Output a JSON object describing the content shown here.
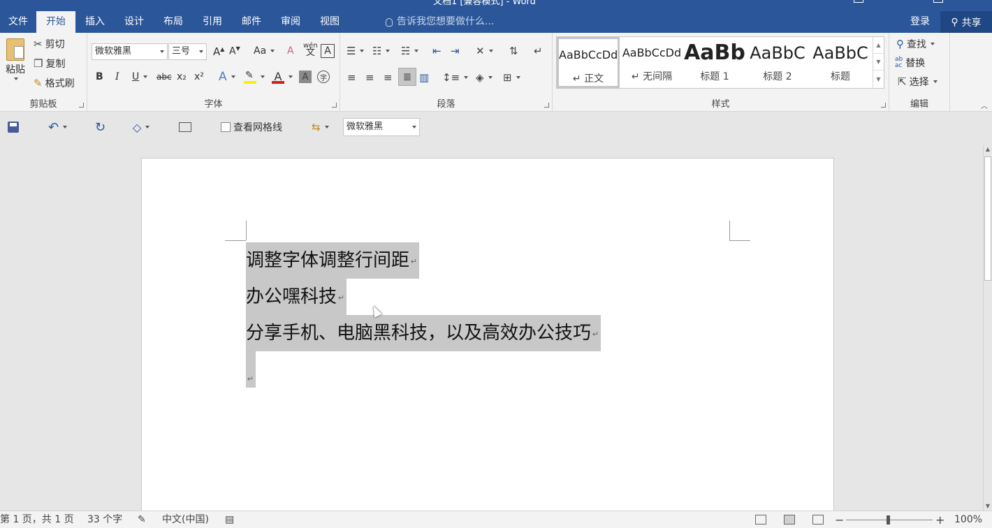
{
  "window": {
    "title": "文档1 [兼容模式] - Word"
  },
  "menu": {
    "file": "文件",
    "tabs": [
      "开始",
      "插入",
      "设计",
      "布局",
      "引用",
      "邮件",
      "审阅",
      "视图"
    ],
    "active_tab": "开始",
    "tell_me": "告诉我您想要做什么...",
    "login": "登录",
    "share": "共享"
  },
  "ribbon": {
    "clipboard": {
      "label": "剪贴板",
      "paste": "粘贴",
      "cut": "剪切",
      "copy": "复制",
      "format_painter": "格式刷"
    },
    "font": {
      "label": "字体",
      "font_name": "微软雅黑",
      "font_size": "三号",
      "change_case": "Aa",
      "clear_format": "A",
      "phonetic": "wén",
      "char_border": "A",
      "bold": "B",
      "italic": "I",
      "underline": "U",
      "strike": "abc",
      "subscript": "x₂",
      "superscript": "x²",
      "font_color_letter": "A",
      "enclose": "字"
    },
    "paragraph": {
      "label": "段落"
    },
    "styles": {
      "label": "样式",
      "items": [
        {
          "preview": "AaBbCcDd",
          "name": "正文"
        },
        {
          "preview": "AaBbCcDd",
          "name": "无间隔"
        },
        {
          "preview": "AaBb",
          "name": "标题 1"
        },
        {
          "preview": "AaBbC",
          "name": "标题 2"
        },
        {
          "preview": "AaBbC",
          "name": "标题"
        }
      ]
    },
    "editing": {
      "label": "编辑",
      "find": "查找",
      "replace": "替换",
      "select": "选择"
    }
  },
  "qat": {
    "gridlines": "查看网格线",
    "font_name": "微软雅黑"
  },
  "document": {
    "paragraphs": [
      "调整字体调整行间距",
      "办公嘿科技",
      "分享手机、电脑黑科技，以及高效办公技巧",
      ""
    ],
    "paragraph_mark": "↵"
  },
  "status": {
    "page": "第 1 页，共 1 页",
    "words": "33 个字",
    "language": "中文(中国)",
    "zoom": "100%"
  },
  "colors": {
    "brand": "#2b579a",
    "selection": "#c8c8c8"
  }
}
